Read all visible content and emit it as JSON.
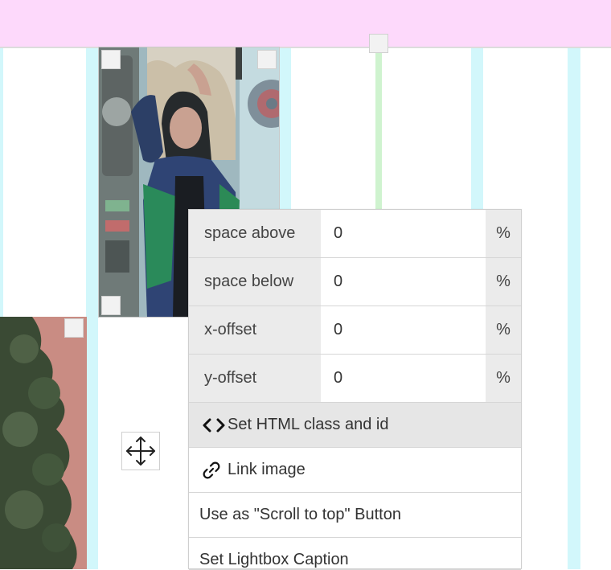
{
  "colors": {
    "top_bar": "#fdd9fb",
    "column_guide": "#d2f7fb",
    "row_guide": "#cff3cf",
    "panel_label_bg": "#ebebeb",
    "active_action_bg": "#e6e6e6"
  },
  "panel": {
    "fields": [
      {
        "label": "space above",
        "value": "0",
        "unit": "%"
      },
      {
        "label": "space below",
        "value": "0",
        "unit": "%"
      },
      {
        "label": "x-offset",
        "value": "0",
        "unit": "%"
      },
      {
        "label": "y-offset",
        "value": "0",
        "unit": "%"
      }
    ],
    "actions": [
      {
        "label": "Set HTML class and id",
        "icon": "code-brackets-icon"
      },
      {
        "label": "Link image",
        "icon": "link-icon"
      },
      {
        "label": "Use as \"Scroll to top\" Button",
        "icon": ""
      },
      {
        "label": "Set Lightbox Caption",
        "icon": ""
      }
    ]
  },
  "images": [
    {
      "name": "woman-photo",
      "icon": "photo"
    },
    {
      "name": "tree-photo",
      "icon": "photo"
    }
  ],
  "move_handle_icon": "move-arrows-icon"
}
